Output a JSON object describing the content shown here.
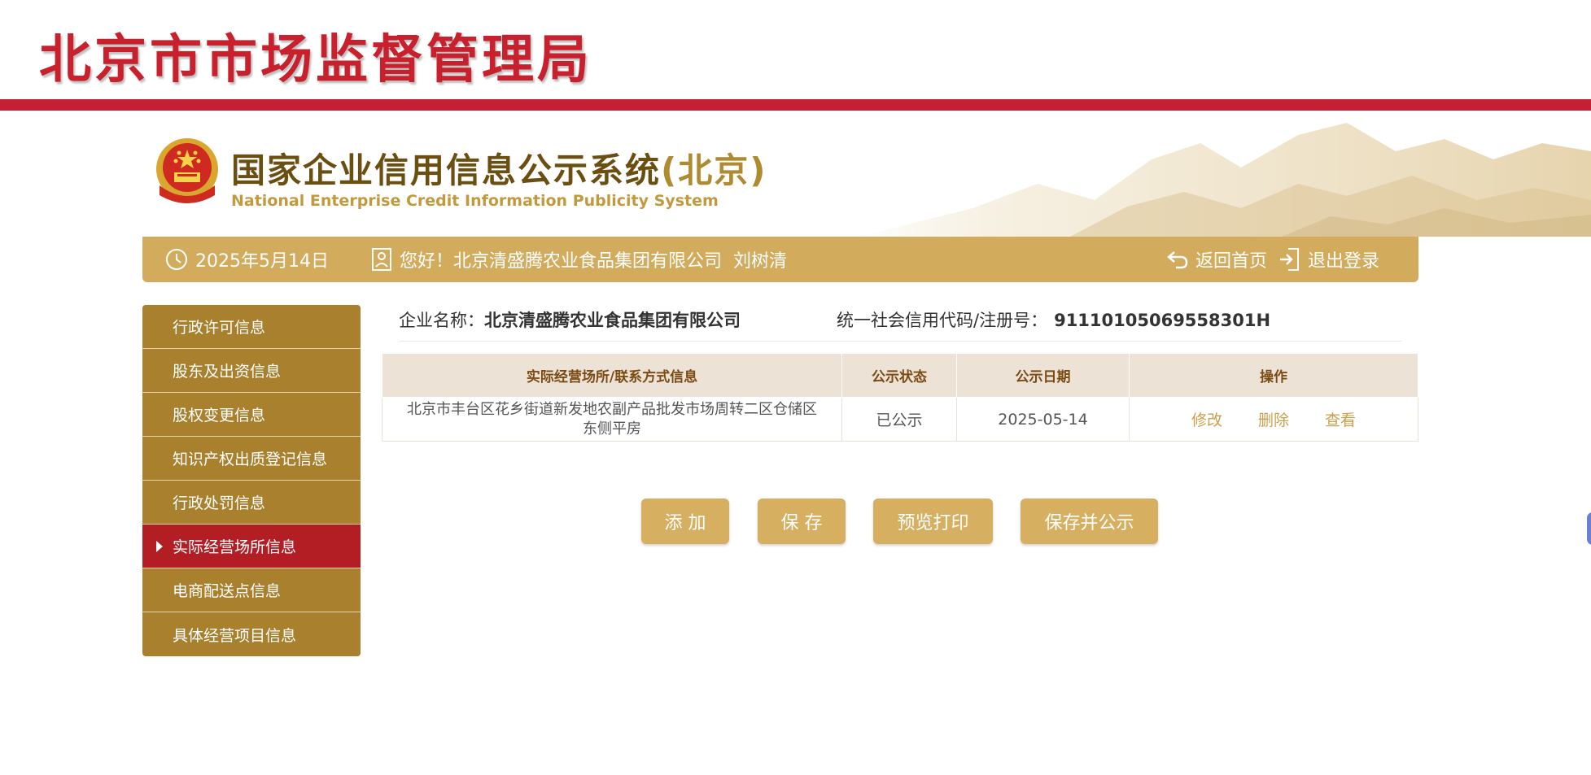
{
  "agency": {
    "title": "北京市市场监督管理局"
  },
  "system": {
    "title": "国家企业信用信息公示系统",
    "region": "(北京)",
    "subtitle": "National Enterprise Credit Information Publicity System"
  },
  "info_bar": {
    "date": "2025年5月14日",
    "greeting": "您好！北京清盛腾农业食品集团有限公司  刘树清",
    "home_label": "返回首页",
    "logout_label": "退出登录"
  },
  "sidebar": {
    "items": [
      {
        "label": "行政许可信息",
        "active": false
      },
      {
        "label": "股东及出资信息",
        "active": false
      },
      {
        "label": "股权变更信息",
        "active": false
      },
      {
        "label": "知识产权出质登记信息",
        "active": false
      },
      {
        "label": "行政处罚信息",
        "active": false
      },
      {
        "label": "实际经营场所信息",
        "active": true
      },
      {
        "label": "电商配送点信息",
        "active": false
      },
      {
        "label": "具体经营项目信息",
        "active": false
      }
    ]
  },
  "company": {
    "name_label": "企业名称：",
    "name": "北京清盛腾农业食品集团有限公司",
    "code_label": "统一社会信用代码/注册号：",
    "code": "91110105069558301H"
  },
  "table": {
    "headers": [
      "实际经营场所/联系方式信息",
      "公示状态",
      "公示日期",
      "操作"
    ],
    "rows": [
      {
        "address_line1": "北京市丰台区花乡街道新发地农副产品批发市场周转二区仓储区",
        "address_line2": "东侧平房",
        "status": "已公示",
        "date": "2025-05-14",
        "actions": [
          "修改",
          "删除",
          "查看"
        ]
      }
    ]
  },
  "buttons": {
    "add": "添 加",
    "save": "保 存",
    "preview": "预览打印",
    "save_publish": "保存并公示"
  },
  "colors": {
    "brand_red": "#c41f33",
    "gold": "#d3ab5c",
    "sidebar_gold": "#a8802e",
    "sidebar_active": "#b21e24",
    "link": "#c9a04c"
  }
}
